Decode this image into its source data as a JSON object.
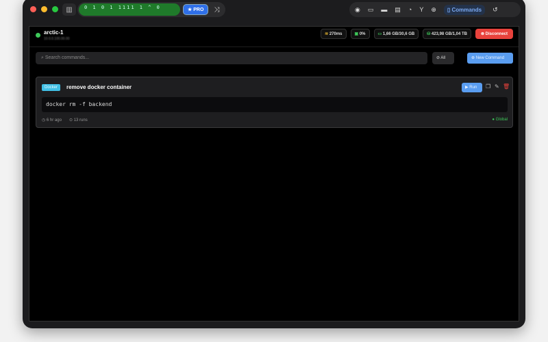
{
  "titlebar": {
    "matrix_text": "0  1    0 1 1111  1 ^ 0",
    "pro_label": "★ PRO",
    "commands_label": "Commands"
  },
  "server": {
    "name": "arctic-1",
    "address": "10.0.0.100.00.00"
  },
  "stats": {
    "latency": "270ms",
    "cpu": "0%",
    "memory": "1,66 GB/30,6 GB",
    "disk": "423,98 GB/1,04 TB"
  },
  "disconnect_label": "Disconnect",
  "search": {
    "placeholder": "Search commands..."
  },
  "filter_label": "All",
  "new_command_label": "New Command",
  "commands": [
    {
      "tag": "Docker",
      "title": "remove docker container",
      "command": "docker rm -f backend",
      "time": "6 hr ago",
      "runs": "13 runs",
      "scope": "Global",
      "run_label": "Run"
    }
  ],
  "colors": {
    "accent": "#5a9df0",
    "danger": "#e8423c",
    "success": "#3ec95a",
    "tag": "#41c0e6"
  }
}
